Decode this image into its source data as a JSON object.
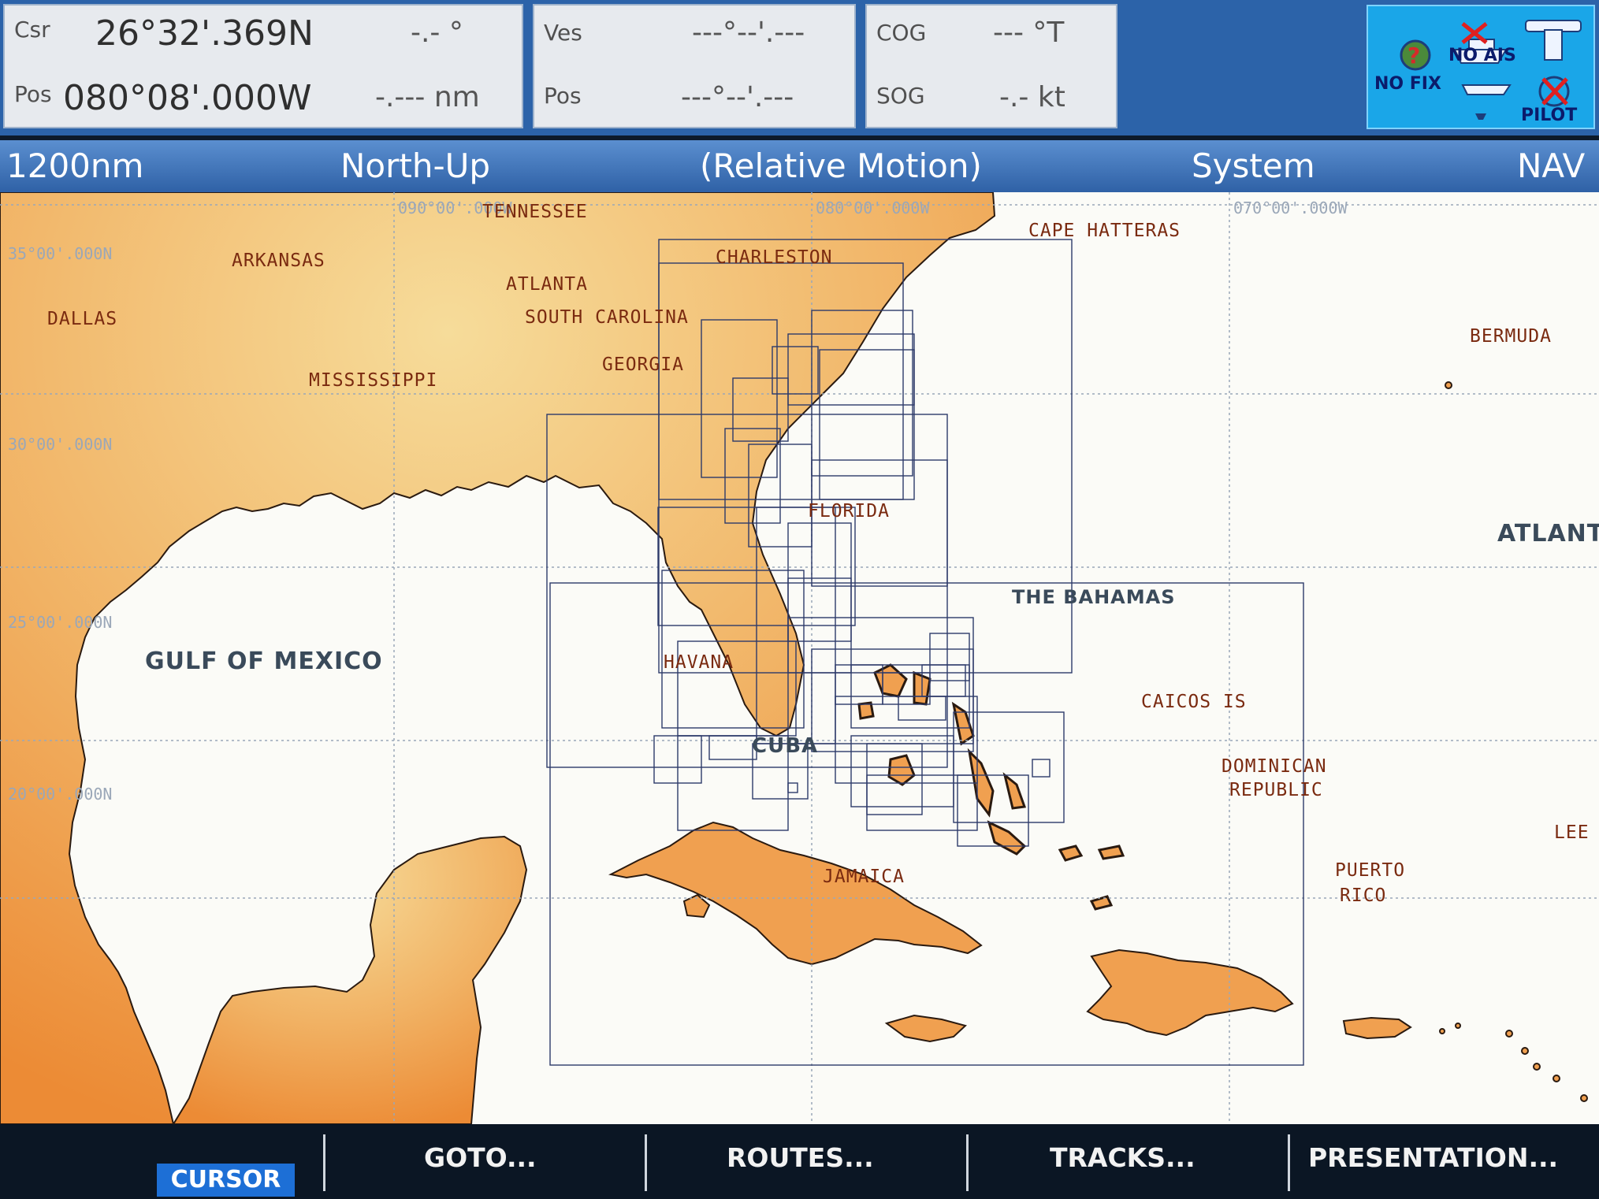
{
  "readouts": {
    "csr_label": "Csr",
    "csr_lat": "26°32'.369N",
    "csr_bearing": "-.- °",
    "pos_label": "Pos",
    "csr_lon": "080°08'.000W",
    "csr_range": "-.--- nm",
    "ves_label": "Ves",
    "ves_lat": "---°--'.---",
    "ves_pos_label": "Pos",
    "ves_lon": "---°--'.---",
    "cog_label": "COG",
    "cog_value": "--- °T",
    "sog_label": "SOG",
    "sog_value": "-.- kt"
  },
  "status_panel": {
    "no_fix": "NO FIX",
    "no_ais": "NO AIS",
    "pilot": "PILOT"
  },
  "header": {
    "range": "1200nm",
    "orientation": "North-Up",
    "motion": "(Relative Motion)",
    "mode": "System",
    "page": "NAV"
  },
  "grid_labels": {
    "lon_90": "090°00'.000W",
    "lon_80": "080°00'.000W",
    "lon_70": "070°00'.000W",
    "lat_35": "35°00'.000N",
    "lat_30": "30°00'.000N",
    "lat_25": "25°00'.000N",
    "lat_20": "20°00'.000N"
  },
  "places": {
    "tennessee": "TENNESSEE",
    "cape_hatteras": "CAPE HATTERAS",
    "arkansas": "ARKANSAS",
    "charleston": "CHARLESTON",
    "atlanta": "ATLANTA",
    "dallas": "DALLAS",
    "south_carolina": "SOUTH CAROLINA",
    "bermuda": "BERMUDA",
    "georgia": "GEORGIA",
    "mississippi": "MISSISSIPPI",
    "florida": "FLORIDA",
    "atlantic": "ATLANT",
    "bahamas": "THE BAHAMAS",
    "gulf": "GULF OF MEXICO",
    "havana": "HAVANA",
    "caicos": "CAICOS IS",
    "cuba": "CUBA",
    "dominican": "DOMINICAN",
    "republic": "REPUBLIC",
    "lee": "LEE",
    "jamaica": "JAMAICA",
    "puerto": "PUERTO",
    "rico": "RICO"
  },
  "softkeys": {
    "cursor": "CURSOR",
    "goto": "GOTO...",
    "routes": "ROUTES...",
    "tracks": "TRACKS...",
    "presentation": "PRESENTATION..."
  },
  "colors": {
    "land": "#f0a050",
    "sea": "#fbfbf7",
    "topbar": "#2c63a9",
    "status": "#1aa6e8"
  }
}
